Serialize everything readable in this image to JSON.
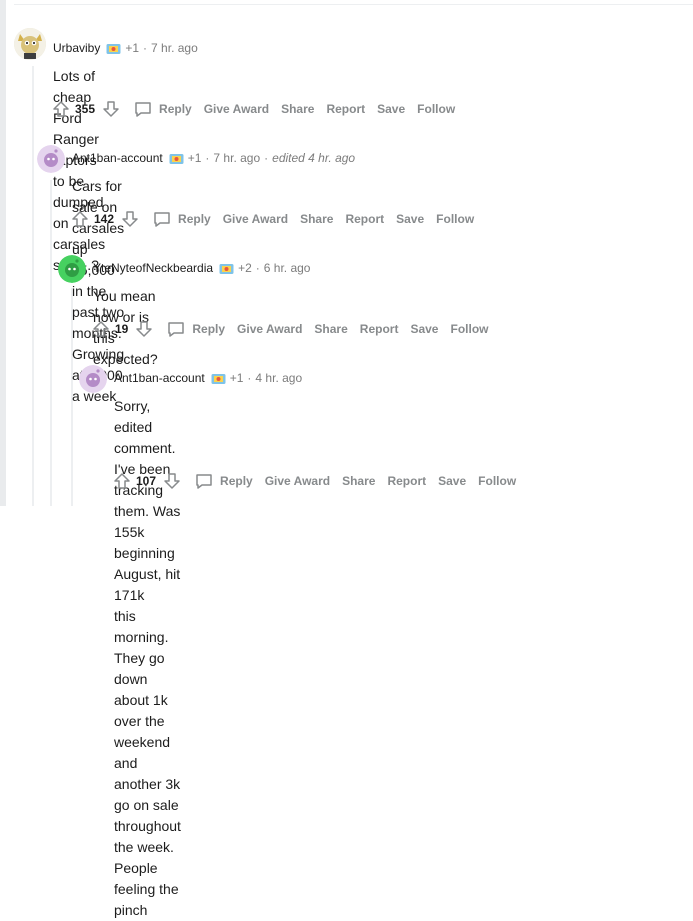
{
  "comments": [
    {
      "author": "Urbaviby",
      "karma": "+1",
      "time": "7 hr. ago",
      "edited": "",
      "body": "Lots of cheap Ford Ranger raptors to be dumped on carsales soon..?",
      "score": "355",
      "avatar_color": "#d9c27a"
    },
    {
      "author": "Ant1ban-account",
      "karma": "+1",
      "time": "7 hr. ago",
      "edited": "edited 4 hr. ago",
      "body": "Cars for sale on carsales up 15,000 in the past two months. Growing at 2,000 a week",
      "score": "142",
      "avatar_color": "#c9a0dc"
    },
    {
      "author": "YteNyteofNeckbeardia",
      "karma": "+2",
      "time": "6 hr. ago",
      "edited": "",
      "body": "You mean now or is this expected?",
      "score": "19",
      "avatar_color": "#46d160"
    },
    {
      "author": "Ant1ban-account",
      "karma": "+1",
      "time": "4 hr. ago",
      "edited": "",
      "body_lines": [
        "Sorry, edited comment. I've been tracking them. Was 155k beginning August, hit 171k",
        "this morning. They go down about 1k over the weekend and another 3k go on sale",
        "throughout the week. People feeling the pinch"
      ],
      "score": "107",
      "avatar_color": "#c9a0dc"
    }
  ],
  "actions": {
    "reply": "Reply",
    "give_award": "Give Award",
    "share": "Share",
    "report": "Report",
    "save": "Save",
    "follow": "Follow"
  },
  "separator": "·"
}
